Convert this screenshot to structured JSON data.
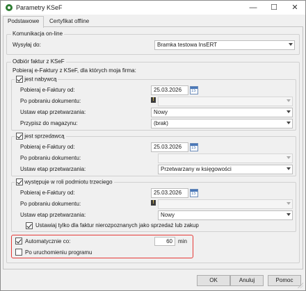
{
  "window": {
    "title": "Parametry KSeF",
    "minimize": "—",
    "maximize": "☐",
    "close": "✕"
  },
  "tabs": [
    {
      "label": "Podstawowe",
      "active": true
    },
    {
      "label": "Certyfikat offline",
      "active": false
    }
  ],
  "komunikacja": {
    "legend": "Komunikacja on-line",
    "send_label": "Wysyłaj do:",
    "send_value": "Bramka testowa InsERT"
  },
  "odbior": {
    "legend": "Odbiór faktur z KSeF",
    "intro": "Pobieraj e-Faktury z KSeF, dla których moja firma:",
    "nabywca": {
      "label": "jest nabywcą",
      "checked": true,
      "date_label": "Pobieraj e-Faktury od:",
      "date_value": "25.03.2026",
      "after_label": "Po pobraniu dokumentu:",
      "stage_label": "Ustaw etap przetwarzania:",
      "stage_value": "Nowy",
      "warehouse_label": "Przypisz do magazynu:",
      "warehouse_value": "(brak)"
    },
    "sprzedawca": {
      "label": "jest sprzedawcą",
      "checked": true,
      "date_label": "Pobieraj e-Faktury od:",
      "date_value": "25.03.2026",
      "after_label": "Po pobraniu dokumentu:",
      "stage_label": "Ustaw etap przetwarzania:",
      "stage_value": "Przetwarzany w księgowości"
    },
    "trzeci": {
      "label": "występuje w roli podmiotu trzeciego",
      "checked": true,
      "date_label": "Pobieraj e-Faktury od:",
      "date_value": "25.03.2026",
      "after_label": "Po pobraniu dokumentu:",
      "stage_label": "Ustaw etap przetwarzania:",
      "stage_value": "Nowy",
      "only_label": "Ustawiaj tylko dla faktur nierozpoznanych jako sprzedaż lub zakup",
      "only_checked": true
    },
    "auto": {
      "label": "Automatycznie co:",
      "checked": true,
      "value": "60",
      "unit": "min"
    },
    "startup": {
      "label": "Po uruchomieniu programu",
      "checked": false
    }
  },
  "calendar_day": "15",
  "warn_glyph": "!",
  "buttons": {
    "ok": "OK",
    "cancel": "Anuluj",
    "help": "Pomoc"
  },
  "colors": {
    "highlight": "#e53935",
    "calendar": "#4a78b8"
  }
}
